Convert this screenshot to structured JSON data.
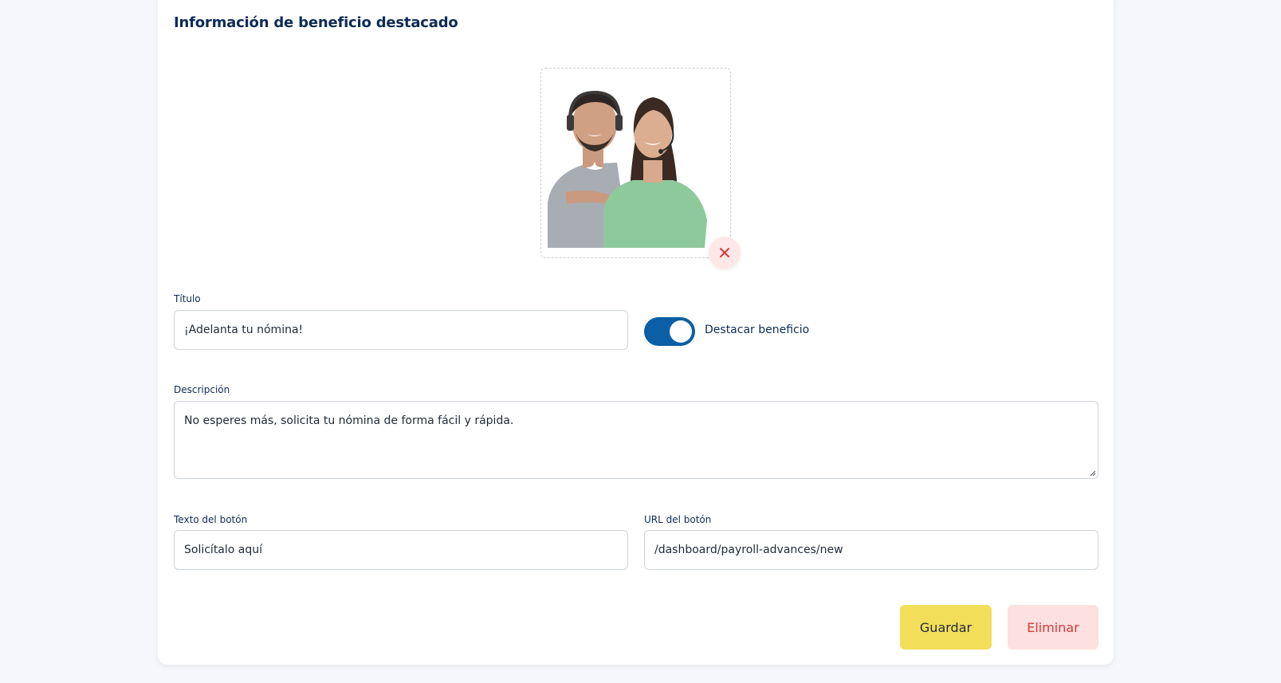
{
  "section": {
    "title": "Información de beneficio destacado"
  },
  "image": {
    "icons": {
      "remove": "close-icon"
    },
    "colors": {
      "remove": "#d63a3a"
    }
  },
  "form": {
    "title_label": "Título",
    "title_value": "¡Adelanta tu nómina!",
    "highlight_toggle": {
      "label": "Destacar beneficio",
      "checked": true
    },
    "description_label": "Descripción",
    "description_value": "No esperes más, solicita tu nómina de forma fácil y rápida.",
    "button_text_label": "Texto del botón",
    "button_text_value": "Solicítalo aquí",
    "button_url_label": "URL del botón",
    "button_url_value": "/dashboard/payroll-advances/new"
  },
  "actions": {
    "save_label": "Guardar",
    "delete_label": "Eliminar"
  },
  "colors": {
    "primary": "#0a5fa6",
    "heading": "#0d2b55",
    "save_bg": "#f3de5a",
    "delete_bg": "#fde0e0",
    "delete_text": "#d63a3a"
  }
}
